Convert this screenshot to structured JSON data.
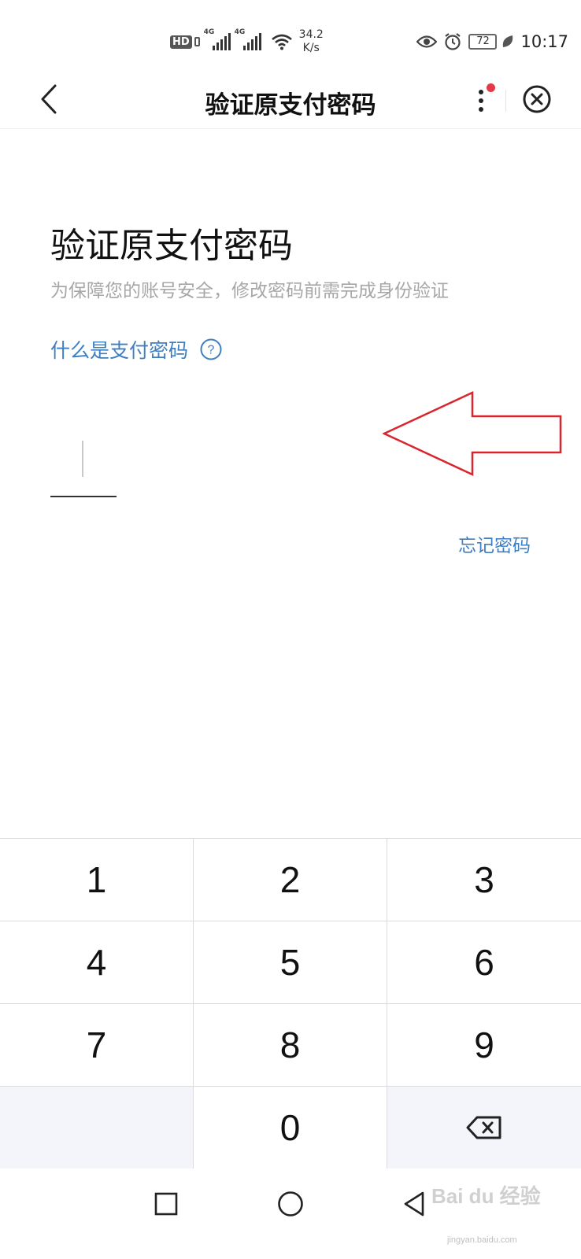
{
  "status_bar": {
    "hd_label": "HD",
    "network_1": "4G",
    "network_2": "4G",
    "speed_value": "34.2",
    "speed_unit": "K/s",
    "battery": "72",
    "time": "10:17"
  },
  "nav": {
    "title": "验证原支付密码"
  },
  "content": {
    "heading": "验证原支付密码",
    "subtitle": "为保障您的账号安全，修改密码前需完成身份验证",
    "help_link": "什么是支付密码",
    "forgot_password": "忘记密码"
  },
  "keypad": {
    "keys": [
      "1",
      "2",
      "3",
      "4",
      "5",
      "6",
      "7",
      "8",
      "9",
      "",
      "0",
      "backspace-icon"
    ]
  },
  "watermark": {
    "text": "Bai du 经验",
    "sub": "jingyan.baidu.com"
  },
  "colors": {
    "link": "#3e7ec2",
    "annotation_arrow": "#d9262e",
    "badge": "#e8374a"
  }
}
